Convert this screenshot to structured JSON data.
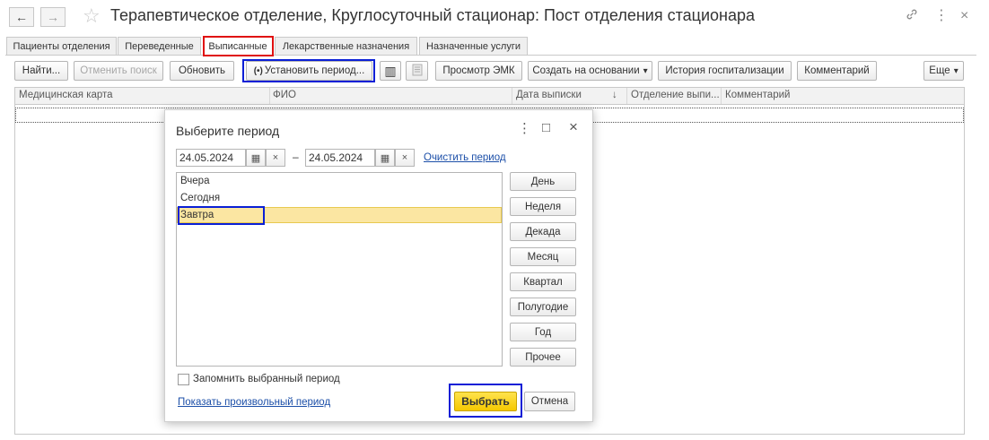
{
  "window": {
    "title": "Терапевтическое отделение, Круглосуточный стационар: Пост отделения стационара",
    "back_icon": "←",
    "forward_icon": "→",
    "star_icon": "☆",
    "link_icon": "🔗",
    "more_icon": "⋮",
    "close_icon": "×"
  },
  "tabs": [
    {
      "label": "Пациенты отделения"
    },
    {
      "label": "Переведенные"
    },
    {
      "label": "Выписанные"
    },
    {
      "label": "Лекарственные назначения"
    },
    {
      "label": "Назначенные услуги"
    }
  ],
  "toolbar": {
    "find": "Найти...",
    "cancel_search": "Отменить поиск",
    "refresh": "Обновить",
    "set_period": "Установить период...",
    "set_period_icon": "(•)",
    "barcode_icon": "▥",
    "view_emk": "Просмотр ЭМК",
    "create_based_on": "Создать на основании",
    "dropdown_arrow": "▾",
    "hospitalization_history": "История госпитализации",
    "comment": "Комментарий",
    "more": "Еще"
  },
  "table": {
    "columns": [
      "Медицинская карта",
      "ФИО",
      "Дата выписки",
      "Отделение  выпи...",
      "Комментарий"
    ],
    "sort_arrow": "↓"
  },
  "dialog": {
    "title": "Выберите период",
    "more_icon": "⋮",
    "maximize_icon": "□",
    "close_icon": "×",
    "date_from": "24.05.2024",
    "date_to": "24.05.2024",
    "calendar_icon": "▦",
    "clear_icon": "×",
    "dash": "–",
    "clear_period": "Очистить период",
    "list_items": [
      "Вчера",
      "Сегодня",
      "Завтра"
    ],
    "selected_item": "Завтра",
    "period_buttons": [
      "День",
      "Неделя",
      "Декада",
      "Месяц",
      "Квартал",
      "Полугодие",
      "Год",
      "Прочее"
    ],
    "remember_period": "Запомнить выбранный период",
    "remember_checked": false,
    "show_custom_period": "Показать произвольный период",
    "select": "Выбрать",
    "cancel": "Отмена"
  },
  "colors": {
    "highlight_blue": "#0a1fd6",
    "highlight_red": "#e01010",
    "primary_yellow": "#f5c800",
    "selection_yellow": "#fbe6a2",
    "link_blue": "#1c4fa8"
  }
}
